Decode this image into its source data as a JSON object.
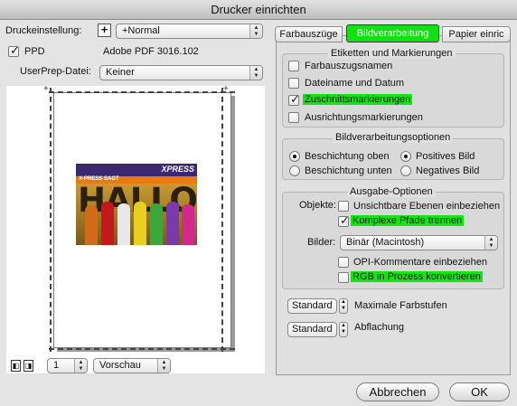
{
  "window": {
    "title": "Drucker einrichten"
  },
  "left": {
    "preset_label": "Druckeinstellung:",
    "preset_value": "+Normal",
    "ppd_label": "PPD",
    "ppd_value": "Adobe PDF 3016.102",
    "userprep_label": "UserPrep-Datei:",
    "userprep_value": "Keiner",
    "page_number": "1",
    "view_value": "Vorschau",
    "preview_image": {
      "brand": "XPRESS",
      "headline": "HALLO",
      "banner": "X-PRESS SAGT"
    }
  },
  "tabs": [
    {
      "label": "Farbauszüge"
    },
    {
      "label": "Bildverarbeitung"
    },
    {
      "label": "Papier einric"
    }
  ],
  "marks": {
    "title": "Etiketten und Markierungen",
    "items": [
      {
        "label": "Farbauszugsnamen",
        "checked": false
      },
      {
        "label": "Dateiname und Datum",
        "checked": false
      },
      {
        "label": "Zuschnittsmarkierungen",
        "checked": true
      },
      {
        "label": "Ausrichtungsmarkierungen",
        "checked": false
      }
    ]
  },
  "processing": {
    "title": "Bildverarbeitungsoptionen",
    "coating_top": "Beschichtung oben",
    "coating_bottom": "Beschichtung unten",
    "positive": "Positives Bild",
    "negative": "Negatives Bild"
  },
  "output": {
    "title": "Ausgabe-Optionen",
    "objects_label": "Objekte:",
    "invisible_layers": "Unsichtbare Ebenen einbeziehen",
    "complex_paths": "Komplexe Pfade trennen",
    "images_label": "Bilder:",
    "images_value": "Binär (Macintosh)",
    "opi": "OPI-Kommentare einbeziehen",
    "rgb": "RGB in Prozess konvertieren"
  },
  "bottom_options": {
    "max_color_value": "Standard",
    "max_color_label": "Maximale Farbstufen",
    "flatten_value": "Standard",
    "flatten_label": "Abflachung"
  },
  "buttons": {
    "cancel": "Abbrechen",
    "ok": "OK"
  },
  "colors": {
    "highlight": "#12e612",
    "active_tab": "#11e011"
  }
}
